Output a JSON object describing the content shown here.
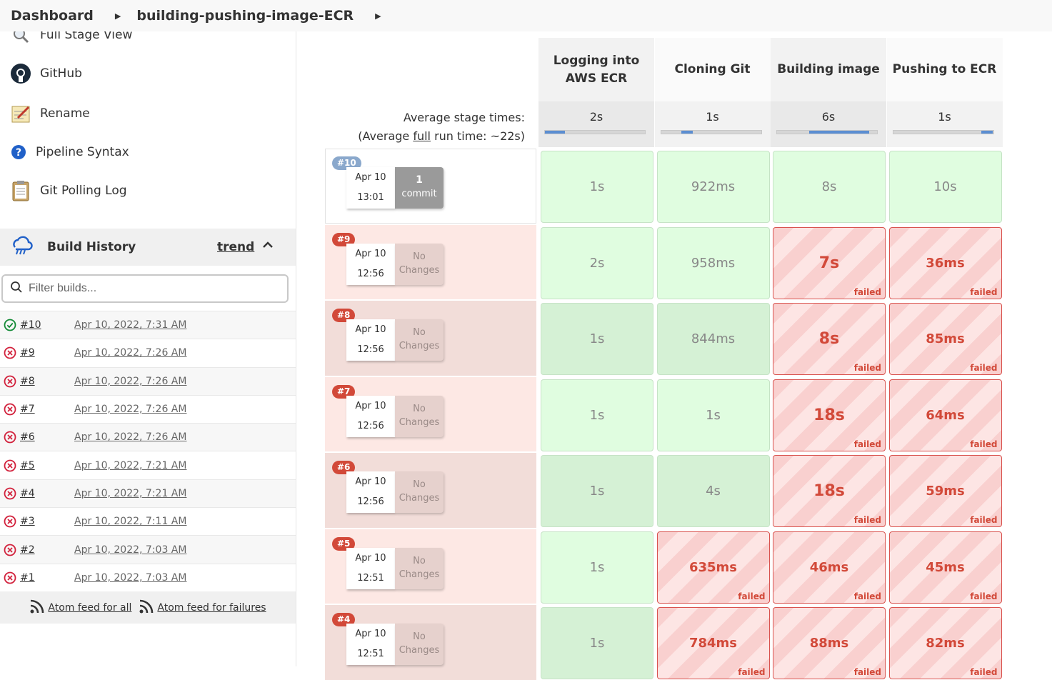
{
  "breadcrumb": {
    "items": [
      "Dashboard",
      "building-pushing-image-ECR"
    ]
  },
  "sidebar": {
    "tasks": [
      {
        "label": "Full Stage View",
        "icon": "magnifier-icon"
      },
      {
        "label": "GitHub",
        "icon": "github-icon"
      },
      {
        "label": "Rename",
        "icon": "notepad-icon"
      },
      {
        "label": "Pipeline Syntax",
        "icon": "help-icon"
      },
      {
        "label": "Git Polling Log",
        "icon": "clipboard-icon"
      }
    ]
  },
  "build_history": {
    "title": "Build History",
    "trend_label": "trend",
    "filter_placeholder": "Filter builds...",
    "builds": [
      {
        "number": "#10",
        "date": "Apr 10, 2022, 7:31 AM",
        "status": "success"
      },
      {
        "number": "#9",
        "date": "Apr 10, 2022, 7:26 AM",
        "status": "failed"
      },
      {
        "number": "#8",
        "date": "Apr 10, 2022, 7:26 AM",
        "status": "failed"
      },
      {
        "number": "#7",
        "date": "Apr 10, 2022, 7:26 AM",
        "status": "failed"
      },
      {
        "number": "#6",
        "date": "Apr 10, 2022, 7:26 AM",
        "status": "failed"
      },
      {
        "number": "#5",
        "date": "Apr 10, 2022, 7:21 AM",
        "status": "failed"
      },
      {
        "number": "#4",
        "date": "Apr 10, 2022, 7:21 AM",
        "status": "failed"
      },
      {
        "number": "#3",
        "date": "Apr 10, 2022, 7:11 AM",
        "status": "failed"
      },
      {
        "number": "#2",
        "date": "Apr 10, 2022, 7:03 AM",
        "status": "failed"
      },
      {
        "number": "#1",
        "date": "Apr 10, 2022, 7:03 AM",
        "status": "failed"
      }
    ],
    "feed_all": "Atom feed for all",
    "feed_failures": "Atom feed for failures"
  },
  "stage_view": {
    "avg_label_line1": "Average stage times:",
    "avg_label_line2_pre": "(Average ",
    "avg_label_line2_link": "full",
    "avg_label_line2_post": " run time: ~22s)",
    "stages": [
      {
        "name": "Logging into AWS ECR",
        "avg": "2s",
        "avg_fraction": 0.2
      },
      {
        "name": "Cloning Git",
        "avg": "1s",
        "avg_fraction": 0.12
      },
      {
        "name": "Building image",
        "avg": "6s",
        "avg_fraction": 0.6
      },
      {
        "name": "Pushing to ECR",
        "avg": "1s",
        "avg_fraction": 0.12
      }
    ],
    "runs": [
      {
        "badge": "#10",
        "status": "success",
        "date": "Apr 10",
        "time": "13:01",
        "changes_count": "1",
        "changes_label": "commit",
        "cells": [
          {
            "t": "1s",
            "s": "success"
          },
          {
            "t": "922ms",
            "s": "success"
          },
          {
            "t": "8s",
            "s": "success"
          },
          {
            "t": "10s",
            "s": "success"
          }
        ]
      },
      {
        "badge": "#9",
        "status": "failed",
        "date": "Apr 10",
        "time": "12:56",
        "changes_label": "No Changes",
        "cells": [
          {
            "t": "2s",
            "s": "success"
          },
          {
            "t": "958ms",
            "s": "success"
          },
          {
            "t": "7s",
            "s": "failed"
          },
          {
            "t": "36ms",
            "s": "failed"
          }
        ]
      },
      {
        "badge": "#8",
        "status": "failed",
        "date": "Apr 10",
        "time": "12:56",
        "changes_label": "No Changes",
        "cells": [
          {
            "t": "1s",
            "s": "success"
          },
          {
            "t": "844ms",
            "s": "success"
          },
          {
            "t": "8s",
            "s": "failed"
          },
          {
            "t": "85ms",
            "s": "failed"
          }
        ]
      },
      {
        "badge": "#7",
        "status": "failed",
        "date": "Apr 10",
        "time": "12:56",
        "changes_label": "No Changes",
        "cells": [
          {
            "t": "1s",
            "s": "success"
          },
          {
            "t": "1s",
            "s": "success"
          },
          {
            "t": "18s",
            "s": "failed"
          },
          {
            "t": "64ms",
            "s": "failed"
          }
        ]
      },
      {
        "badge": "#6",
        "status": "failed",
        "date": "Apr 10",
        "time": "12:56",
        "changes_label": "No Changes",
        "cells": [
          {
            "t": "1s",
            "s": "success"
          },
          {
            "t": "4s",
            "s": "success"
          },
          {
            "t": "18s",
            "s": "failed"
          },
          {
            "t": "59ms",
            "s": "failed"
          }
        ]
      },
      {
        "badge": "#5",
        "status": "failed",
        "date": "Apr 10",
        "time": "12:51",
        "changes_label": "No Changes",
        "cells": [
          {
            "t": "1s",
            "s": "success"
          },
          {
            "t": "635ms",
            "s": "failed"
          },
          {
            "t": "46ms",
            "s": "failed"
          },
          {
            "t": "45ms",
            "s": "failed"
          }
        ]
      },
      {
        "badge": "#4",
        "status": "failed",
        "date": "Apr 10",
        "time": "12:51",
        "changes_label": "No Changes",
        "cells": [
          {
            "t": "1s",
            "s": "success"
          },
          {
            "t": "784ms",
            "s": "failed"
          },
          {
            "t": "88ms",
            "s": "failed"
          },
          {
            "t": "82ms",
            "s": "failed"
          }
        ]
      }
    ],
    "failed_label": "failed"
  },
  "colors": {
    "success_cell": "#e0fde0",
    "failed_border": "#d9534f",
    "failed_text": "#d24939",
    "avg_bar_fill": "#5b8ed2",
    "build_success_badge": "#8aa8cc"
  }
}
